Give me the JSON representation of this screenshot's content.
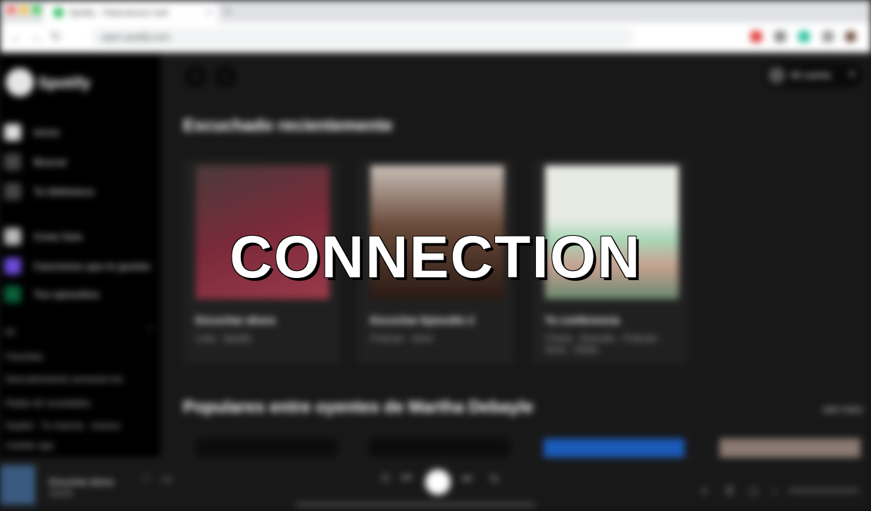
{
  "browser": {
    "tab_title": "Spotify – Reproductor web",
    "tab_close": "×",
    "new_tab": "+",
    "url": "open.spotify.com",
    "back": "←",
    "forward": "→",
    "reload": "↻"
  },
  "sidebar": {
    "logo_text": "Spotify",
    "nav": [
      {
        "label": "Inicio"
      },
      {
        "label": "Buscar"
      },
      {
        "label": "Tu biblioteca"
      },
      {
        "label": "Crear lista"
      },
      {
        "label": "Canciones que te gustan"
      },
      {
        "label": "Tus episodios"
      }
    ],
    "library_header": "Mi",
    "collapse": "›",
    "playlists": [
      "Favoritas",
      "Descubrimiento semanal mix",
      "Radar de novedades",
      "Daylist · Tu mezcla · música",
      "Instalar app"
    ]
  },
  "main": {
    "user_name": "Mi cuenta",
    "user_caret": "▾",
    "section1_title": "Escuchado recientemente",
    "cards": [
      {
        "title": "Escuchar ahora",
        "sub": "Lista · Spotify"
      },
      {
        "title": "Escuchar Episodio 2",
        "sub": "Podcast · Serie"
      },
      {
        "title": "Tu conferencia",
        "sub": "Charla · Episodio · Podcast · Serie · Radio"
      }
    ],
    "section2_title": "Populares entre oyentes de Martha Debayle",
    "see_all": "VER TODO"
  },
  "player": {
    "title": "Escuchar ahora",
    "artist": "Spotify",
    "shuffle": "⤨",
    "prev": "⏮",
    "next": "⏭",
    "repeat": "↻"
  },
  "overlay": {
    "text": "CONNECTION"
  },
  "colors": {
    "accent": "#1db954",
    "background": "#121212",
    "sidebar": "#000000"
  }
}
